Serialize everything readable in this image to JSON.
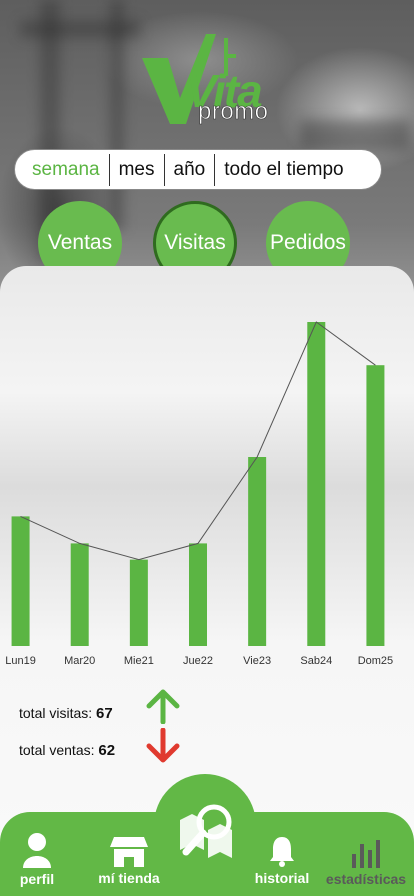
{
  "logo": {
    "brand": "Vita",
    "sub": "promo"
  },
  "period": {
    "items": [
      "semana",
      "mes",
      "año",
      "todo el tiempo"
    ],
    "selected": "semana"
  },
  "metrics": {
    "items": [
      "Ventas",
      "Visitas",
      "Pedidos"
    ],
    "selected": "Visitas"
  },
  "chart_data": {
    "type": "bar",
    "categories": [
      "Lun19",
      "Mar20",
      "Mie21",
      "Jue22",
      "Vie23",
      "Sab24",
      "Dom25"
    ],
    "values": [
      24,
      19,
      16,
      19,
      35,
      60,
      52
    ],
    "ylim": [
      0,
      60
    ],
    "overlay_line": true,
    "grid": false,
    "colors": {
      "bar": "#5bb543",
      "line": "#555555"
    }
  },
  "totals": {
    "visitas_label": "total visitas:",
    "visitas_value": "67",
    "ventas_label": "total ventas:",
    "ventas_value": "62"
  },
  "nav": {
    "perfil": "perfil",
    "tienda": "mí tienda",
    "historial": "historial",
    "estadisticas": "estadísticas"
  },
  "colors": {
    "accent": "#5bb543",
    "down": "#e03a2f"
  }
}
